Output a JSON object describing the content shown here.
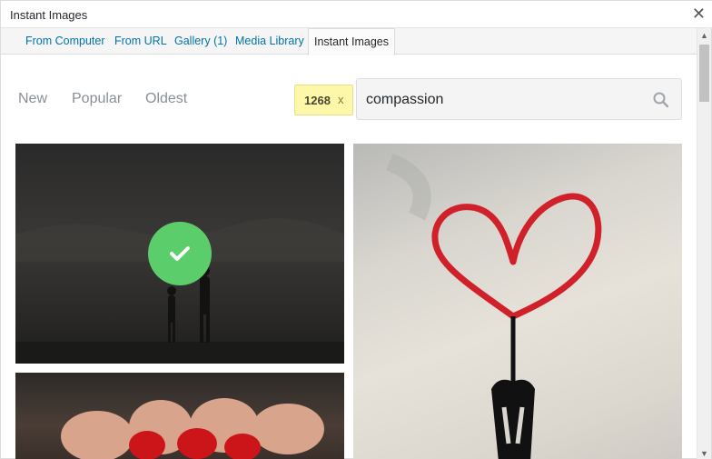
{
  "window": {
    "title": "Instant Images",
    "close_symbol": "✕"
  },
  "tabs": [
    {
      "label": "From Computer"
    },
    {
      "label": "From URL"
    },
    {
      "label": "Gallery (1)"
    },
    {
      "label": "Media Library"
    },
    {
      "label": "Instant Images",
      "active": true
    }
  ],
  "sort": {
    "new": "New",
    "popular": "Popular",
    "oldest": "Oldest"
  },
  "results": {
    "count": "1268",
    "clear": "x"
  },
  "search": {
    "value": "compassion",
    "icon": "search-icon"
  },
  "photos": [
    {
      "subject": "silhouette couple at dusk",
      "selected": true
    },
    {
      "subject": "red heart graffiti on wall",
      "selected": false
    },
    {
      "subject": "hands painted with red hearts",
      "selected": false
    }
  ],
  "colors": {
    "accent_link": "#0073aa",
    "selected_check": "#5ccd6b",
    "badge_bg": "#fdf8a9"
  }
}
